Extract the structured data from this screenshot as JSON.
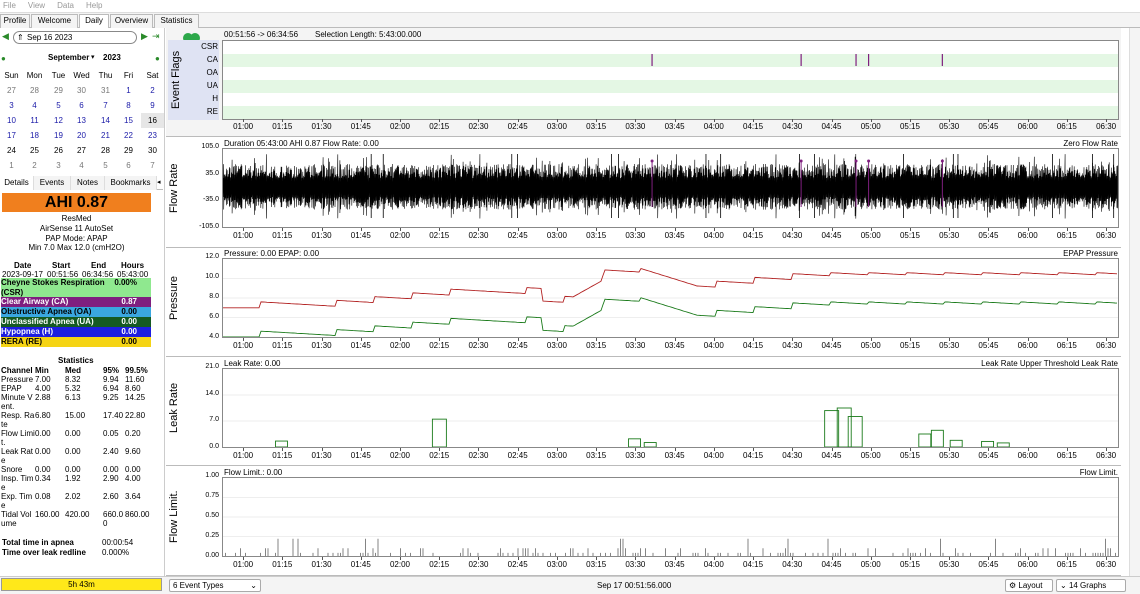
{
  "menu": [
    "File",
    "View",
    "Data",
    "Help"
  ],
  "tabs": [
    "Profile",
    "Welcome",
    "Daily",
    "Overview",
    "Statistics"
  ],
  "date_value": "Sep 16 2023",
  "calendar": {
    "month": "September",
    "year": "2023",
    "weekdays": [
      "Sun",
      "Mon",
      "Tue",
      "Wed",
      "Thu",
      "Fri",
      "Sat"
    ],
    "weeks": [
      [
        "27",
        "28",
        "29",
        "30",
        "31",
        "1",
        "2"
      ],
      [
        "3",
        "4",
        "5",
        "6",
        "7",
        "8",
        "9"
      ],
      [
        "10",
        "11",
        "12",
        "13",
        "14",
        "15",
        "16"
      ],
      [
        "17",
        "18",
        "19",
        "20",
        "21",
        "22",
        "23"
      ],
      [
        "24",
        "25",
        "26",
        "27",
        "28",
        "29",
        "30"
      ],
      [
        "1",
        "2",
        "3",
        "4",
        "5",
        "6",
        "7"
      ]
    ]
  },
  "left_tabs": [
    "Details",
    "Events",
    "Notes",
    "Bookmarks"
  ],
  "ahi": "AHI 0.87",
  "device": {
    "brand": "ResMed",
    "model": "AirSense 11 AutoSet",
    "mode": "PAP Mode: APAP",
    "pressure": "Min 7.0 Max 12.0 (cmH2O)"
  },
  "session": {
    "headers": [
      "Date",
      "Start",
      "End",
      "Hours"
    ],
    "values": [
      "2023-09-17",
      "00:51:56",
      "06:34:56",
      "05:43:00"
    ]
  },
  "events": [
    {
      "label": "Cheyne Stokes Respiration (CSR)",
      "value": "0.00%",
      "color": "#8fe88f"
    },
    {
      "label": "Clear Airway (CA)",
      "value": "0.87",
      "color": "#7f1f7f",
      "text": "#fff"
    },
    {
      "label": "Obstructive Apnea (OA)",
      "value": "0.00",
      "color": "#3aa7e0"
    },
    {
      "label": "Unclassified Apnea (UA)",
      "value": "0.00",
      "color": "#155a22",
      "text": "#fff"
    },
    {
      "label": "Hypopnea (H)",
      "value": "0.00",
      "color": "#1d1de0",
      "text": "#fff"
    },
    {
      "label": "RERA (RE)",
      "value": "0.00",
      "color": "#f5d414"
    }
  ],
  "stats": {
    "title": "Statistics",
    "headers": [
      "Channel",
      "Min",
      "Med",
      "95%",
      "99.5%"
    ],
    "rows": [
      [
        "Pressure",
        "7.00",
        "8.32",
        "9.94",
        "11.60"
      ],
      [
        "EPAP",
        "4.00",
        "5.32",
        "6.94",
        "8.60"
      ],
      [
        "Minute Vent.",
        "2.88",
        "6.13",
        "9.25",
        "14.25"
      ],
      [
        "Resp. Rate",
        "6.80",
        "15.00",
        "17.40",
        "22.80"
      ],
      [
        "Flow Limit.",
        "0.00",
        "0.00",
        "0.05",
        "0.20"
      ],
      [
        "Leak Rate",
        "0.00",
        "0.00",
        "2.40",
        "9.60"
      ],
      [
        "Snore",
        "0.00",
        "0.00",
        "0.00",
        "0.00"
      ],
      [
        "Insp. Time",
        "0.34",
        "1.92",
        "2.90",
        "4.00"
      ],
      [
        "Exp. Time",
        "0.08",
        "2.02",
        "2.60",
        "3.64"
      ],
      [
        "Tidal Volume",
        "160.00",
        "420.00",
        "660.00",
        "860.00"
      ]
    ],
    "apnea_label": "Total time in apnea",
    "apnea_value": "00:00:54",
    "leak_label": "Time over leak redline",
    "leak_value": "0.000%"
  },
  "duration_badge": "5h 43m",
  "time_ticks": [
    "01:00",
    "01:15",
    "01:30",
    "01:45",
    "02:00",
    "02:15",
    "02:30",
    "02:45",
    "03:00",
    "03:15",
    "03:30",
    "03:45",
    "04:00",
    "04:15",
    "04:30",
    "04:45",
    "05:00",
    "05:15",
    "05:30",
    "05:45",
    "06:00",
    "06:15",
    "06:30"
  ],
  "flags": {
    "ylabel": "Event Flags",
    "range": "00:51:56 -> 06:34:56",
    "selection": "Selection Length: 5:43:00.000",
    "rows": [
      "CSR",
      "CA",
      "OA",
      "UA",
      "H",
      "RE"
    ],
    "ca_events_hours": [
      3.6,
      4.55,
      4.9,
      4.98,
      5.45
    ]
  },
  "graphs": [
    {
      "id": "flow",
      "ylabel": "Flow Rate",
      "title": "Duration 05:43:00 AHI 0.87 Flow Rate: 0.00",
      "legend": "Zero Flow Rate",
      "yticks": [
        "105.0",
        "35.0",
        "-35.0",
        "-105.0"
      ]
    },
    {
      "id": "pressure",
      "ylabel": "Pressure",
      "title": "Pressure: 0.00 EPAP: 0.00",
      "legend": "EPAP Pressure",
      "yticks": [
        "12.0",
        "10.0",
        "8.0",
        "6.0",
        "4.0"
      ]
    },
    {
      "id": "leak",
      "ylabel": "Leak Rate",
      "title": "Leak Rate: 0.00",
      "legend": "Leak Rate Upper Threshold Leak Rate",
      "yticks": [
        "21.0",
        "14.0",
        "7.0",
        "0.0"
      ]
    },
    {
      "id": "flowlim",
      "ylabel": "Flow Limit.",
      "title": "Flow Limit.: 0.00",
      "legend": "Flow Limit.",
      "yticks": [
        "1.00",
        "0.75",
        "0.50",
        "0.25",
        "0.00"
      ]
    }
  ],
  "bottom": {
    "event_types": "6 Event Types",
    "center_time": "Sep 17 00:51:56.000",
    "layout": "Layout",
    "graphs": "14 Graphs"
  }
}
